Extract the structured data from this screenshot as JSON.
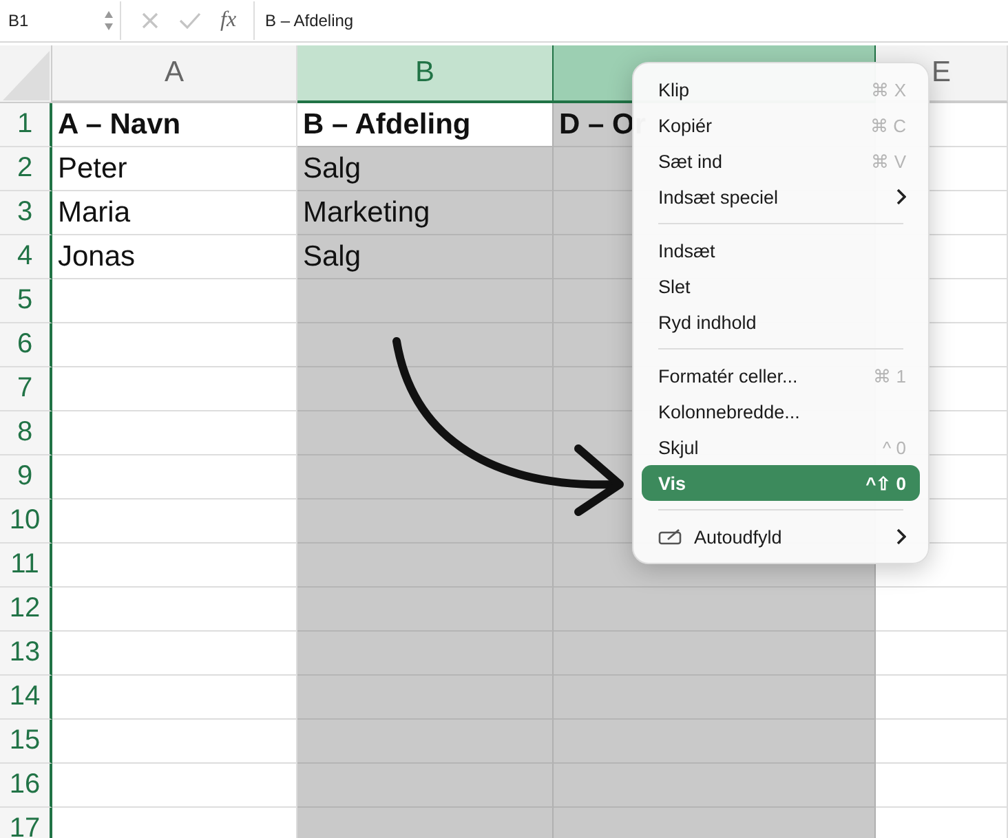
{
  "formula_bar": {
    "name_box": "B1",
    "function_label": "fx",
    "formula": "B – Afdeling"
  },
  "columns": [
    {
      "label": "A",
      "selected": false
    },
    {
      "label": "B",
      "selected": true
    },
    {
      "selected": true
    },
    {
      "label": "E",
      "selected": false
    }
  ],
  "rows": [
    {
      "number": "1",
      "cells": [
        {
          "text": "A – Navn",
          "bold": true
        },
        {
          "text": "B – Afdeling",
          "bold": true,
          "active": true
        },
        {
          "text": "D – Or",
          "bold": true
        },
        null
      ]
    },
    {
      "number": "2",
      "cells": [
        {
          "text": "Peter",
          "bold": false
        },
        {
          "text": "Salg",
          "bold": false
        },
        null,
        null
      ]
    },
    {
      "number": "3",
      "cells": [
        {
          "text": "Maria",
          "bold": false
        },
        {
          "text": "Marketing",
          "bold": false
        },
        null,
        null
      ]
    },
    {
      "number": "4",
      "cells": [
        {
          "text": "Jonas",
          "bold": false
        },
        {
          "text": "Salg",
          "bold": false
        },
        null,
        null
      ]
    },
    {
      "number": "5",
      "cells": [
        null,
        null,
        null,
        null
      ]
    },
    {
      "number": "6",
      "cells": [
        null,
        null,
        null,
        null
      ]
    },
    {
      "number": "7",
      "cells": [
        null,
        null,
        null,
        null
      ]
    },
    {
      "number": "8",
      "cells": [
        null,
        null,
        null,
        null
      ]
    },
    {
      "number": "9",
      "cells": [
        null,
        null,
        null,
        null
      ]
    },
    {
      "number": "10",
      "cells": [
        null,
        null,
        null,
        null
      ]
    },
    {
      "number": "11",
      "cells": [
        null,
        null,
        null,
        null
      ]
    },
    {
      "number": "12",
      "cells": [
        null,
        null,
        null,
        null
      ]
    },
    {
      "number": "13",
      "cells": [
        null,
        null,
        null,
        null
      ]
    },
    {
      "number": "14",
      "cells": [
        null,
        null,
        null,
        null
      ]
    },
    {
      "number": "15",
      "cells": [
        null,
        null,
        null,
        null
      ]
    },
    {
      "number": "16",
      "cells": [
        null,
        null,
        null,
        null
      ]
    },
    {
      "number": "17",
      "cells": [
        null,
        null,
        null,
        null
      ]
    }
  ],
  "context_menu": [
    [
      {
        "label": "Klip",
        "shortcut": "⌘ X",
        "selected": false,
        "submenu": false
      },
      {
        "label": "Kopiér",
        "shortcut": "⌘ C",
        "selected": false,
        "submenu": false
      },
      {
        "label": "Sæt ind",
        "shortcut": "⌘ V",
        "selected": false,
        "submenu": false
      },
      {
        "label": "Indsæt speciel",
        "selected": false,
        "submenu": true
      }
    ],
    [
      {
        "label": "Indsæt",
        "selected": false,
        "submenu": false
      },
      {
        "label": "Slet",
        "selected": false,
        "submenu": false
      },
      {
        "label": "Ryd indhold",
        "selected": false,
        "submenu": false
      }
    ],
    [
      {
        "label": "Formatér celler...",
        "shortcut": "⌘ 1",
        "selected": false,
        "submenu": false
      },
      {
        "label": "Kolonnebredde...",
        "selected": false,
        "submenu": false
      },
      {
        "label": "Skjul",
        "shortcut": "^ 0",
        "selected": false,
        "submenu": false
      },
      {
        "label": "Vis",
        "shortcut": "^⇧ 0",
        "selected": true,
        "submenu": false
      }
    ],
    [
      {
        "label": "Autoudfyld",
        "kind": "autofill",
        "selected": false,
        "submenu": true
      }
    ]
  ]
}
